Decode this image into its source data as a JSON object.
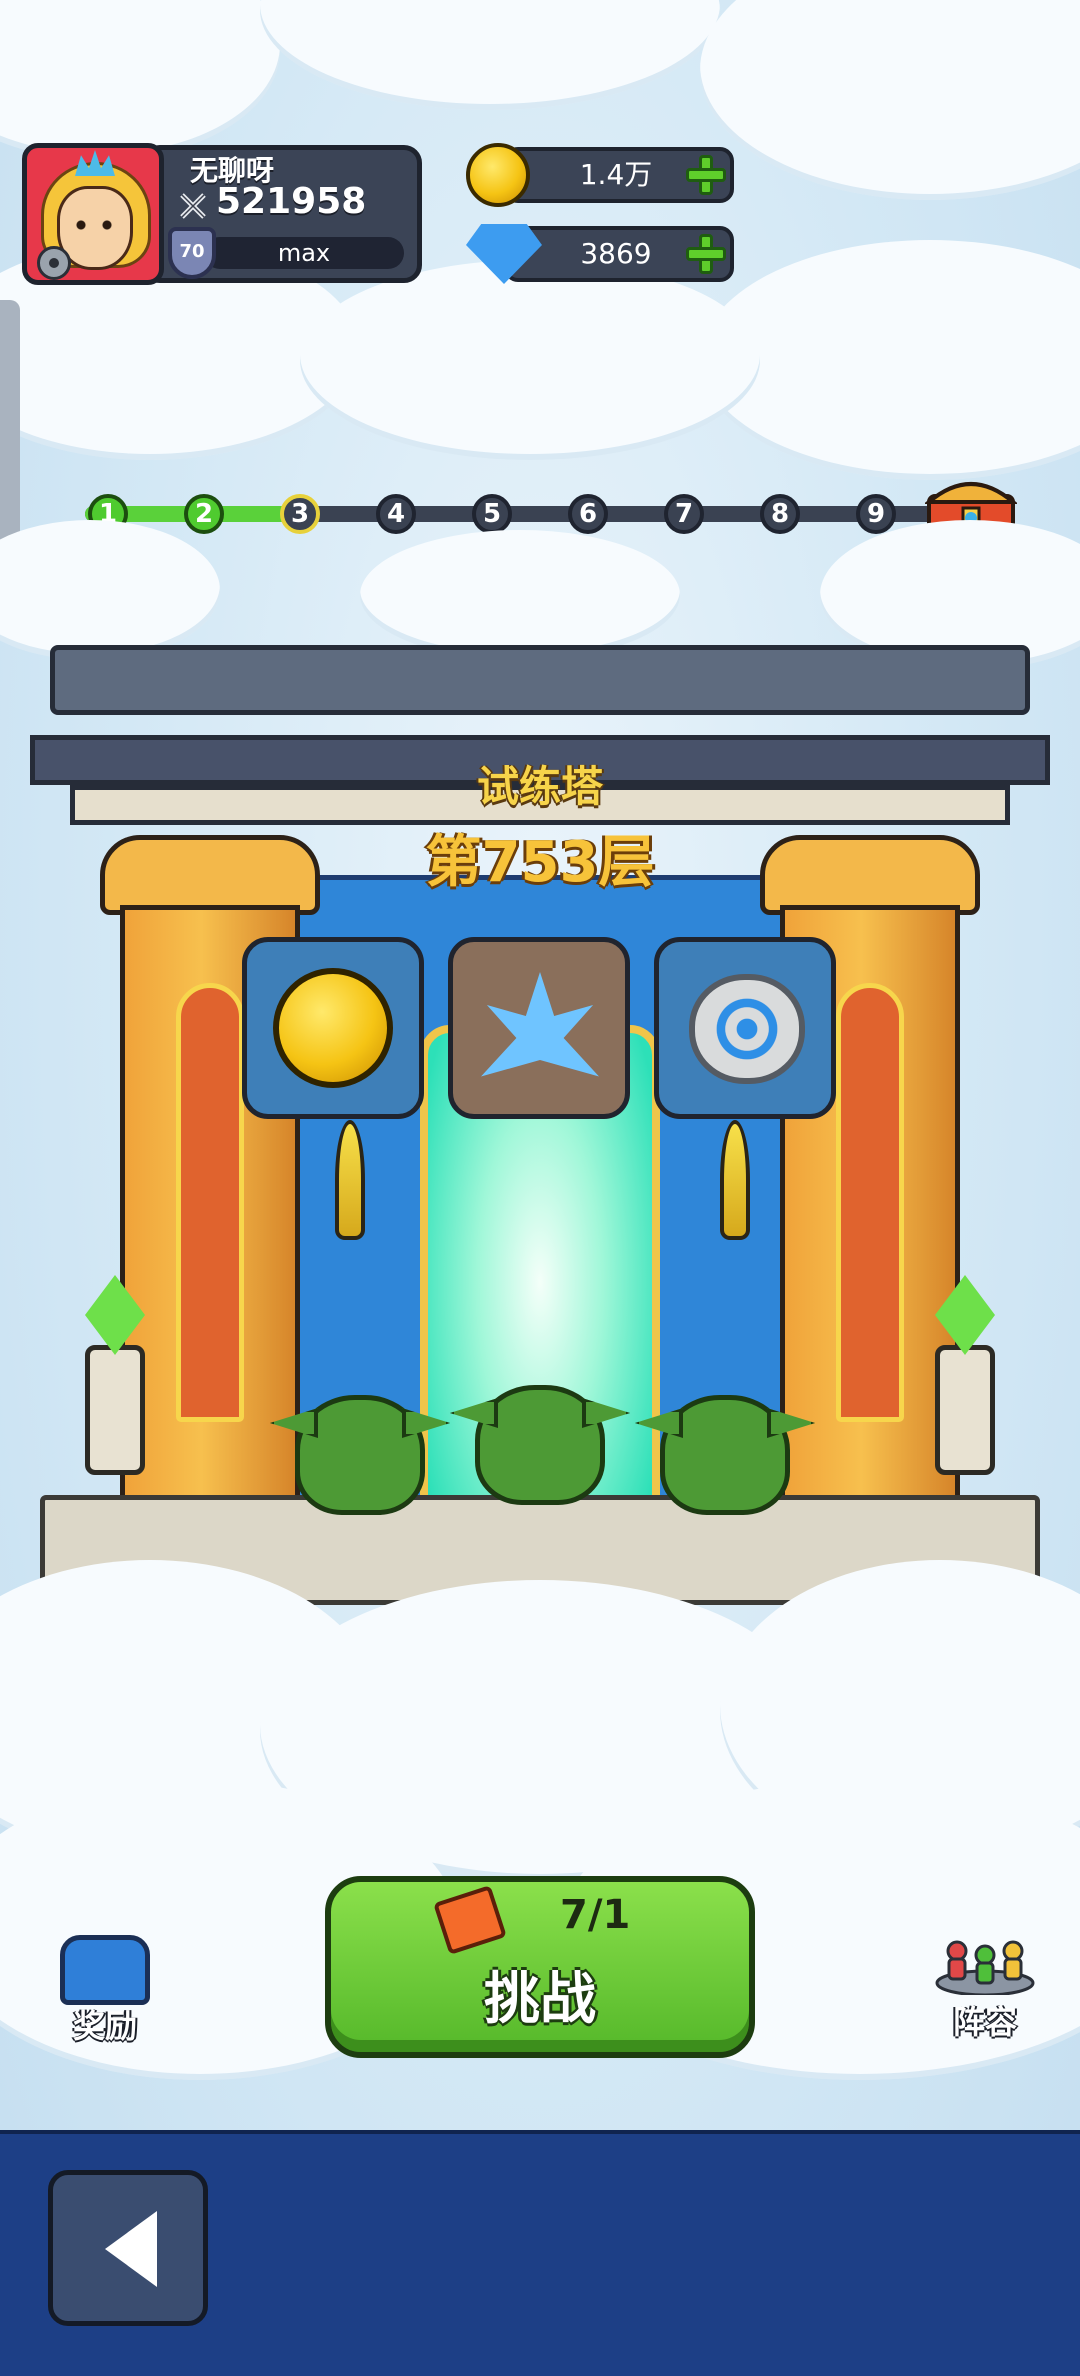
{
  "profile": {
    "name": "无聊呀",
    "power": "521958",
    "level": "70",
    "exp_label": "max"
  },
  "currency": {
    "gold": "1.4万",
    "diamond": "3869"
  },
  "stage_progress": {
    "stages": [
      "1",
      "2",
      "3",
      "4",
      "5",
      "6",
      "7",
      "8",
      "9"
    ],
    "completed": 2,
    "current": "3"
  },
  "tower": {
    "title": "试练塔",
    "floor": "第753层"
  },
  "rewards": [
    "coin",
    "crystal",
    "stone"
  ],
  "challenge": {
    "ticket_count": "7/1",
    "label": "挑战"
  },
  "buttons": {
    "rewards_label": "奖励",
    "lineup_label": "阵容"
  },
  "colors": {
    "progress_active": "#5ad13a",
    "challenge_green": "#6cc93a",
    "bottom_bar": "#1d3f86"
  }
}
